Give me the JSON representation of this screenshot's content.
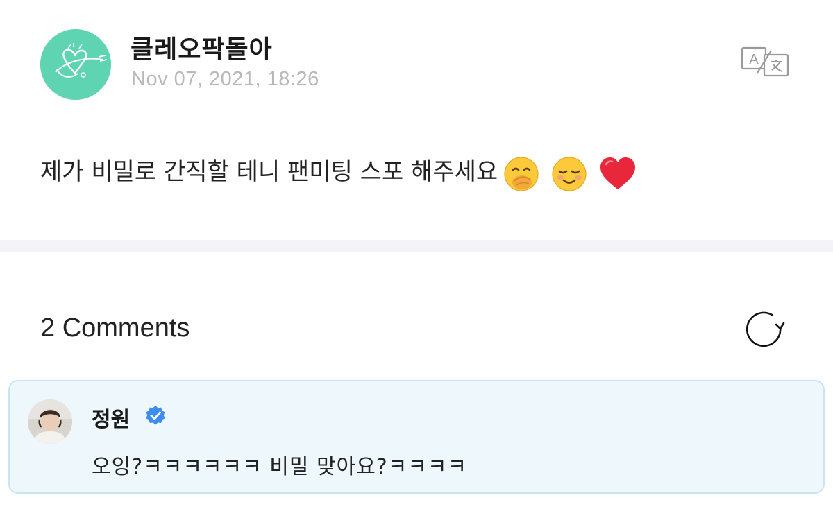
{
  "post": {
    "author_name": "클레오팍돌아",
    "date": "Nov 07, 2021, 18:26",
    "text": "제가 비밀로 간직할 테니  팬미팅 스포 해주세요",
    "emojis": [
      "face-with-hand-over-mouth-emoji",
      "smiling-face-emoji",
      "red-heart-emoji"
    ]
  },
  "comments": {
    "title": "2 Comments",
    "items": [
      {
        "name": "정원",
        "text": "오잉?ㅋㅋㅋㅋㅋㅋ 비밀 맞아요?ㅋㅋㅋㅋ",
        "verified": true
      }
    ]
  },
  "icons": {
    "translate": "translate-icon",
    "refresh": "refresh-icon",
    "verified": "verified-badge-icon"
  },
  "colors": {
    "avatar_bg": "#5ed4b3",
    "date_text": "#b9b9b9",
    "divider": "#f4f4f8",
    "comment_bg": "#eef7fc",
    "comment_border": "#c8e4f5",
    "verified_blue": "#3d8cf0"
  }
}
